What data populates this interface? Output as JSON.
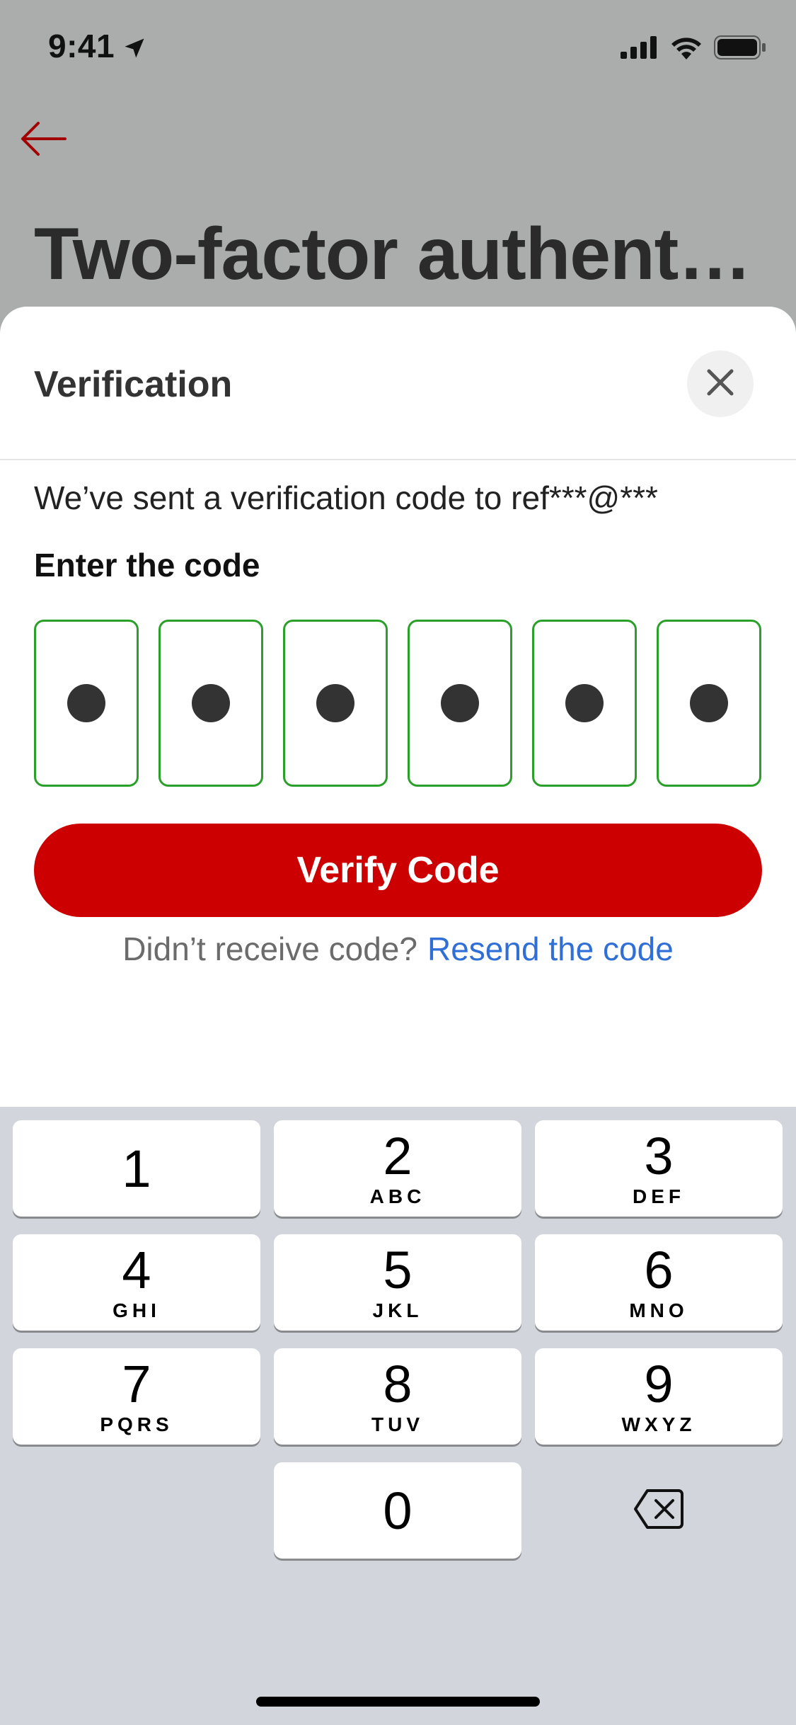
{
  "status_bar": {
    "time": "9:41",
    "icons": [
      "location-arrow-icon",
      "signal-icon",
      "wifi-icon",
      "battery-icon"
    ]
  },
  "background": {
    "back_icon": "arrow-left-icon",
    "title": "Two-factor authentication"
  },
  "sheet": {
    "title": "Verification",
    "close_icon": "close-icon",
    "sent_text": "We’ve sent a verification code to ref***@***",
    "enter_label": "Enter the code",
    "code_digits": [
      "•",
      "•",
      "•",
      "•",
      "•",
      "•"
    ],
    "verify_label": "Verify Code",
    "resend_prompt": "Didn’t receive code?",
    "resend_link": "Resend the code"
  },
  "keyboard": {
    "keys": [
      {
        "digit": "1",
        "letters": ""
      },
      {
        "digit": "2",
        "letters": "ABC"
      },
      {
        "digit": "3",
        "letters": "DEF"
      },
      {
        "digit": "4",
        "letters": "GHI"
      },
      {
        "digit": "5",
        "letters": "JKL"
      },
      {
        "digit": "6",
        "letters": "MNO"
      },
      {
        "digit": "7",
        "letters": "PQRS"
      },
      {
        "digit": "8",
        "letters": "TUV"
      },
      {
        "digit": "9",
        "letters": "WXYZ"
      },
      {
        "digit": "0",
        "letters": ""
      }
    ],
    "delete_icon": "backspace-icon"
  },
  "colors": {
    "accent_red": "#cc0000",
    "code_border_green": "#2aa02a",
    "link_blue": "#2f6fd6"
  }
}
